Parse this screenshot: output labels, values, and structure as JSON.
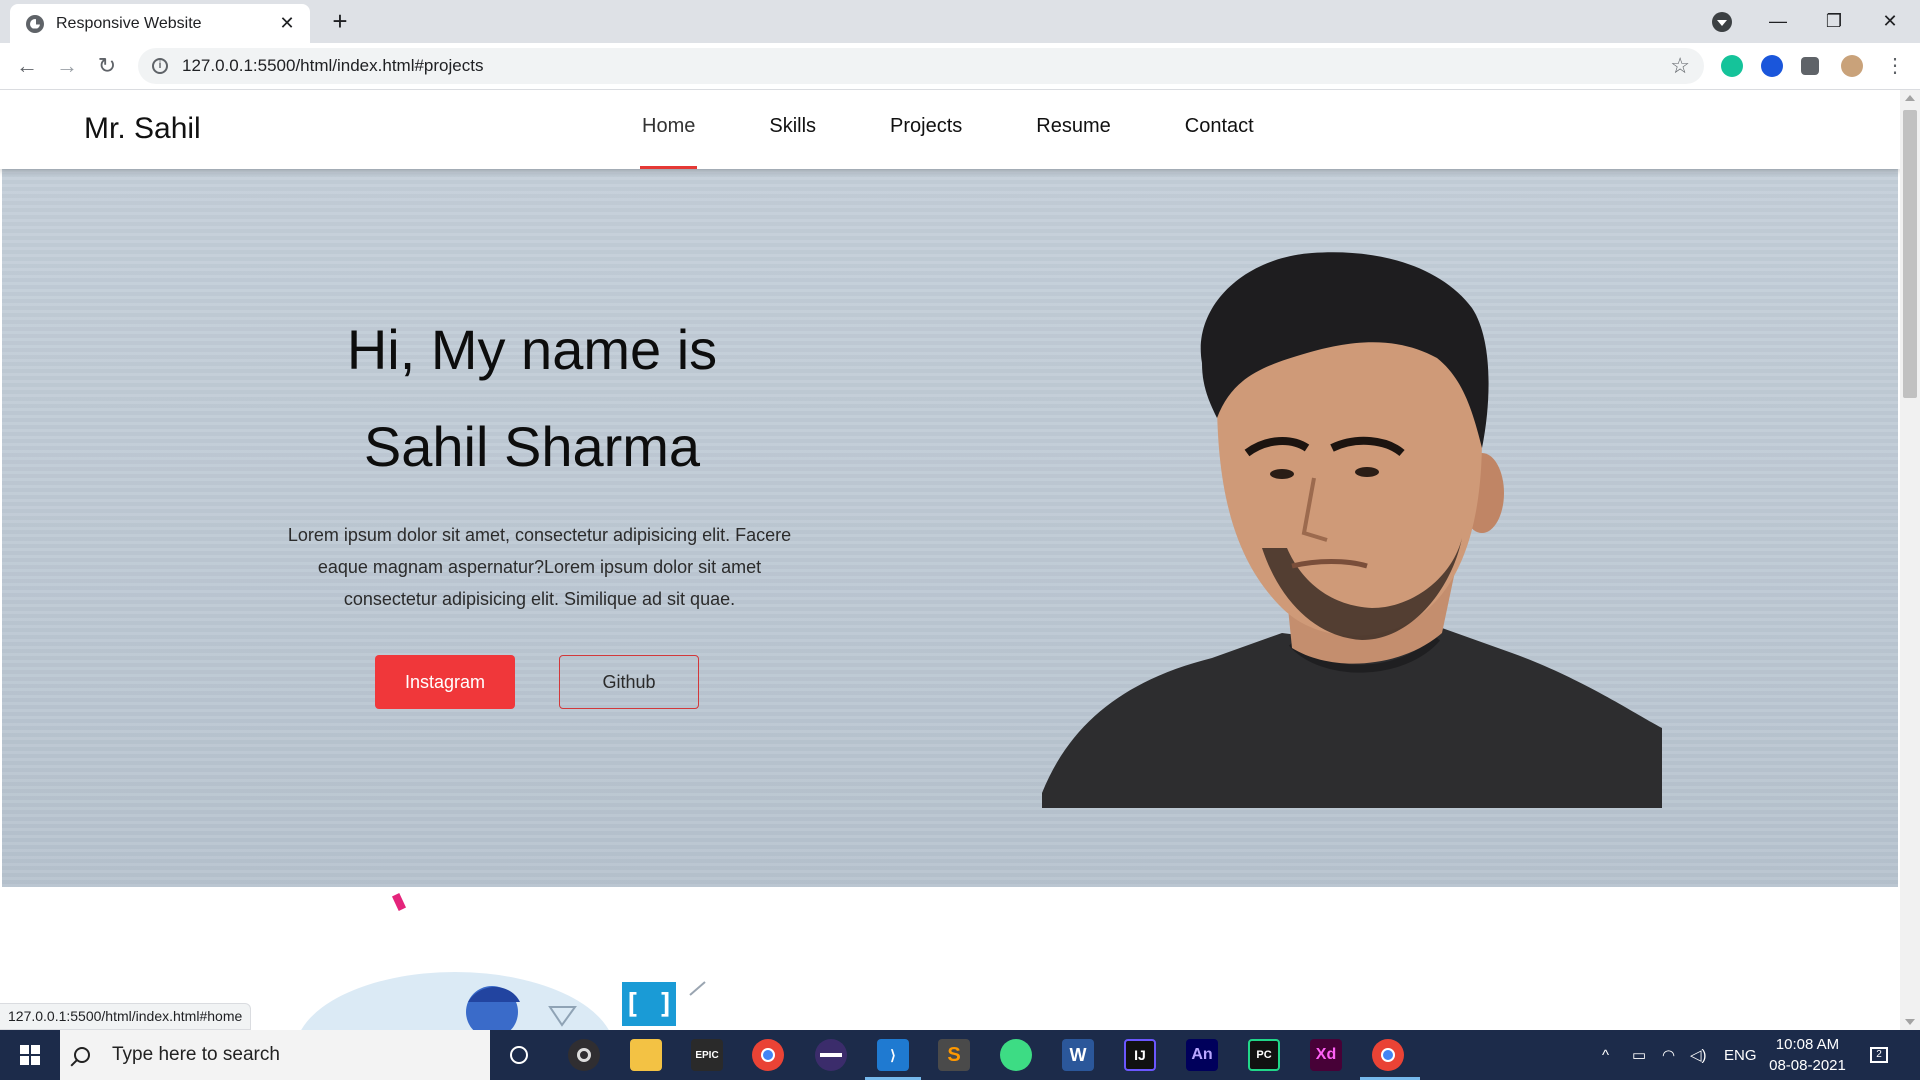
{
  "browser": {
    "tab_title": "Responsive Website",
    "tab_close": "✕",
    "new_tab": "+",
    "url": "127.0.0.1:5500/html/index.html#projects",
    "status_url": "127.0.0.1:5500/html/index.html#home",
    "back": "←",
    "forward": "→",
    "reload": "↻",
    "star": "☆",
    "minimize": "—",
    "restore": "❐",
    "close": "✕"
  },
  "site": {
    "logo": "Mr. Sahil",
    "nav": [
      {
        "label": "Home",
        "active": true
      },
      {
        "label": "Skills"
      },
      {
        "label": "Projects"
      },
      {
        "label": "Resume"
      },
      {
        "label": "Contact"
      }
    ],
    "hero": {
      "line1": "Hi, My name is",
      "line2": "Sahil Sharma",
      "bio": "Lorem ipsum dolor sit amet, consectetur adipisicing elit. Facere eaque magnam aspernatur?Lorem ipsum dolor sit amet consectetur adipisicing elit. Similique ad sit quae.",
      "primary_button": "Instagram",
      "secondary_button": "Github"
    },
    "accent_color": "#f0373a"
  },
  "taskbar": {
    "search_placeholder": "Type here to search",
    "apps": [
      "cortana-icon",
      "obs-icon",
      "file-explorer-icon",
      "epic-games-icon",
      "chrome-icon",
      "eclipse-icon",
      "vscode-icon",
      "sublime-text-icon",
      "android-studio-icon",
      "word-icon",
      "intellij-icon",
      "animate-icon",
      "pycharm-icon",
      "xd-icon",
      "chrome-active-icon"
    ],
    "word_label": "W",
    "ij_label": "IJ",
    "an_label": "An",
    "pc_label": "PC",
    "xd_label": "Xd",
    "epic_label": "EPIC",
    "sublime_label": "S",
    "language": "ENG",
    "time": "10:08 AM",
    "date": "08-08-2021",
    "notifications": "2"
  }
}
